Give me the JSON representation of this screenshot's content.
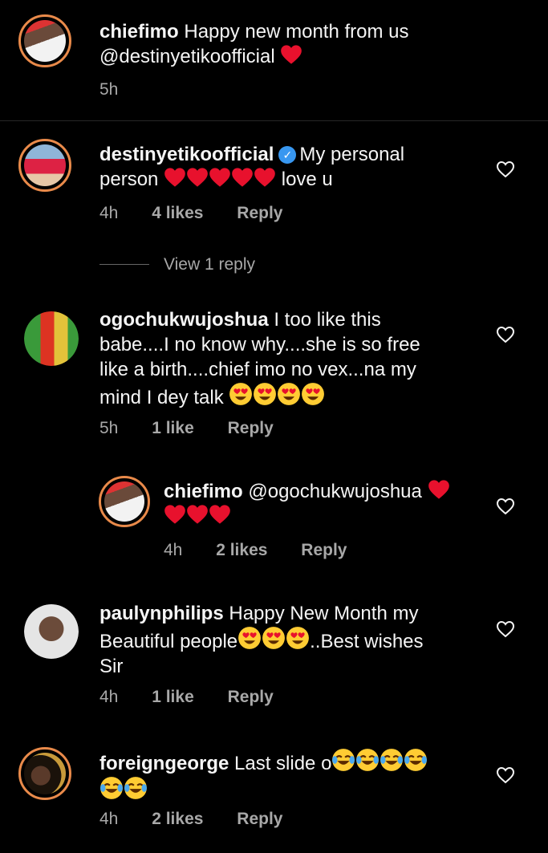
{
  "comments": [
    {
      "username": "chiefimo",
      "text": "Happy new month from us",
      "mention": "@destinyetikoofficial",
      "time": "5h"
    },
    {
      "username": "destinyetikoofficial",
      "text_a": "My personal",
      "text_b": "person",
      "text_c": "love u",
      "time": "4h",
      "likes": "4 likes",
      "reply": "Reply",
      "view_replies": "View 1 reply"
    },
    {
      "username": "ogochukwujoshua",
      "line1": "I too like this",
      "line2": "babe....I no know why....she is so free",
      "line3": "like a birth....chief imo no vex...na my",
      "line4": "mind I dey talk",
      "time": "5h",
      "likes": "1 like",
      "reply": "Reply"
    },
    {
      "username": "chiefimo",
      "mention": "@ogochukwujoshua",
      "time": "4h",
      "likes": "2 likes",
      "reply": "Reply"
    },
    {
      "username": "paulynphilips",
      "line1": "Happy New Month my",
      "line2a": "Beautiful people",
      "line2b": "..Best wishes",
      "line3": "Sir",
      "time": "4h",
      "likes": "1 like",
      "reply": "Reply"
    },
    {
      "username": "foreigngeorge",
      "text": "Last slide o",
      "time": "4h",
      "likes": "2 likes",
      "reply": "Reply"
    }
  ],
  "colors": {
    "heart_red": "#e8112d",
    "ring": "#e98a4a",
    "meta": "#a8a8a8",
    "verified": "#3897f0"
  },
  "icons": {
    "like": "heart-outline-icon",
    "verified": "verified-badge-icon"
  }
}
